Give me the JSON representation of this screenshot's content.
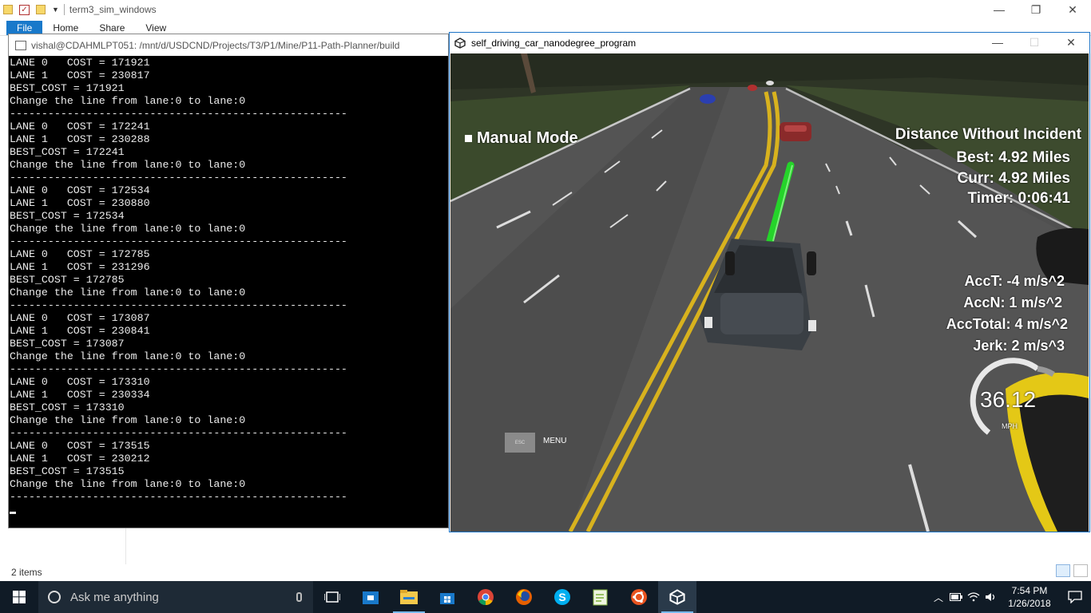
{
  "explorer": {
    "title": "term3_sim_windows",
    "tabs": [
      "File",
      "Home",
      "Share",
      "View"
    ],
    "status": "2 items"
  },
  "terminal": {
    "title": "vishal@CDAHMLPT051: /mnt/d/USDCND/Projects/T3/P1/Mine/P11-Path-Planner/build",
    "lines": [
      "LANE 0   COST = 171921",
      "LANE 1   COST = 230817",
      "BEST_COST = 171921",
      "Change the line from lane:0 to lane:0",
      "-----------------------------------------------------",
      "LANE 0   COST = 172241",
      "LANE 1   COST = 230288",
      "BEST_COST = 172241",
      "Change the line from lane:0 to lane:0",
      "-----------------------------------------------------",
      "LANE 0   COST = 172534",
      "LANE 1   COST = 230880",
      "BEST_COST = 172534",
      "Change the line from lane:0 to lane:0",
      "-----------------------------------------------------",
      "LANE 0   COST = 172785",
      "LANE 1   COST = 231296",
      "BEST_COST = 172785",
      "Change the line from lane:0 to lane:0",
      "-----------------------------------------------------",
      "LANE 0   COST = 173087",
      "LANE 1   COST = 230841",
      "BEST_COST = 173087",
      "Change the line from lane:0 to lane:0",
      "-----------------------------------------------------",
      "LANE 0   COST = 173310",
      "LANE 1   COST = 230334",
      "BEST_COST = 173310",
      "Change the line from lane:0 to lane:0",
      "-----------------------------------------------------",
      "LANE 0   COST = 173515",
      "LANE 1   COST = 230212",
      "BEST_COST = 173515",
      "Change the line from lane:0 to lane:0",
      "-----------------------------------------------------"
    ]
  },
  "simulator": {
    "title": "self_driving_car_nanodegree_program",
    "manual_mode": "Manual Mode",
    "distance_title": "Distance Without Incident",
    "best": "Best: 4.92 Miles",
    "curr": "Curr: 4.92 Miles",
    "timer": "Timer: 0:06:41",
    "acc_t": "AccT: -4 m/s^2",
    "acc_n": "AccN: 1 m/s^2",
    "acc_total": "AccTotal: 4 m/s^2",
    "jerk": "Jerk: 2 m/s^3",
    "speed": "36.12",
    "speed_unit": "MPH",
    "esc_key": "ESC",
    "menu": "MENU"
  },
  "taskbar": {
    "search_placeholder": "Ask me anything",
    "apps": [
      "task-view",
      "store",
      "file-explorer",
      "windows-store",
      "chrome",
      "firefox",
      "skype",
      "notepad-plus",
      "ubuntu",
      "unity"
    ],
    "time": "7:54 PM",
    "date": "1/26/2018"
  },
  "colors": {
    "taskbar_bg": "#101b26",
    "accent": "#1979ca",
    "terminal_bg": "#000000",
    "path_green": "#25d42a",
    "lane_yellow": "#d8b21e"
  }
}
